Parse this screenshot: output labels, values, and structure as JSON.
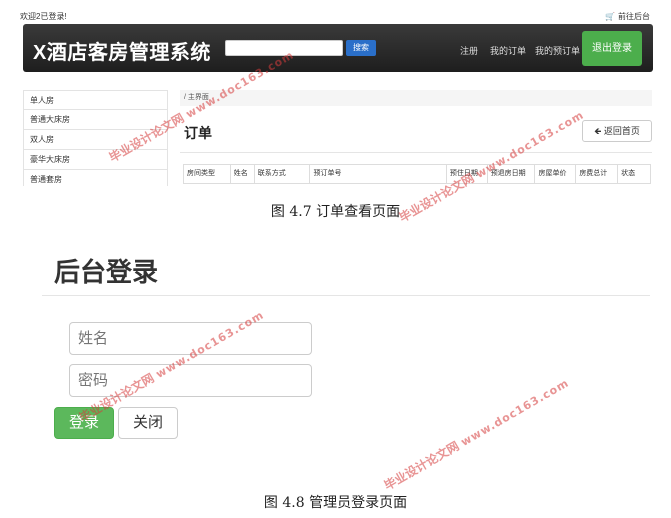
{
  "fig47": {
    "topbar": {
      "welcome": "欢迎2已登录!",
      "backend_link": "前往后台",
      "cart_icon": "cart-icon"
    },
    "navbar": {
      "brand": "X酒店客房管理系统",
      "search_value": "",
      "search_button": "搜索",
      "links": [
        "注册",
        "我的订单",
        "我的预订单"
      ],
      "logout_button": "退出登录",
      "colors": {
        "navbar_bg": "#2a2a2a",
        "search_btn": "#2a6fc9",
        "logout_btn": "#4cae4c"
      }
    },
    "sidebar": {
      "items": [
        "单人房",
        "普通大床房",
        "双人房",
        "豪华大床房",
        "普通套房"
      ]
    },
    "breadcrumb": "/ 主界面",
    "page_title": "订单",
    "back_button": "返回首页",
    "table": {
      "headers": [
        "房间类型",
        "姓名",
        "联系方式",
        "预订单号",
        "预住日期",
        "预退房日期",
        "房屋单价",
        "房费总计",
        "状态"
      ]
    },
    "caption": "图 4.7  订单查看页面"
  },
  "fig48": {
    "title": "后台登录",
    "name_placeholder": "姓名",
    "password_placeholder": "密码",
    "login_button": "登录",
    "close_button": "关闭",
    "colors": {
      "login_btn": "#5cb85c"
    },
    "caption": "图 4.8  管理员登录页面"
  },
  "watermark": {
    "cn": "毕业设计论文网",
    "url": "www.doc163.com"
  }
}
